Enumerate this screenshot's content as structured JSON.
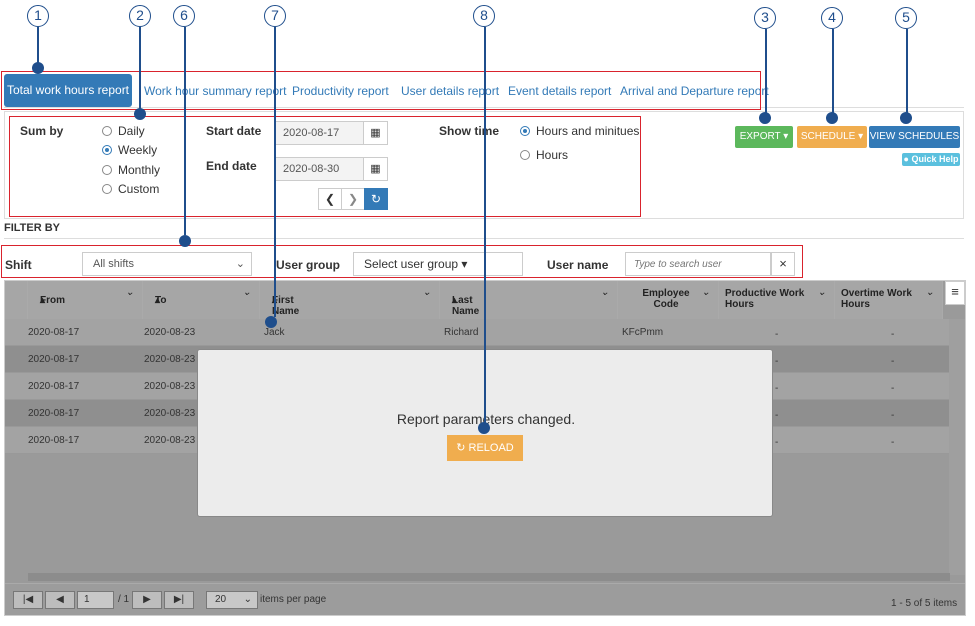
{
  "callouts": [
    "1",
    "2",
    "3",
    "4",
    "5",
    "6",
    "7",
    "8"
  ],
  "tabs": {
    "active": "Total work hours report",
    "items": [
      "Work hour summary report",
      "Productivity report",
      "User details report",
      "Event details report",
      "Arrival and Departure report"
    ]
  },
  "params": {
    "sum_by_label": "Sum by",
    "sum_by_options": [
      "Daily",
      "Weekly",
      "Monthly",
      "Custom"
    ],
    "sum_by_selected": "Weekly",
    "start_date_label": "Start date",
    "start_date": "2020-08-17",
    "end_date_label": "End date",
    "end_date": "2020-08-30",
    "show_time_label": "Show time",
    "show_time_options": [
      "Hours and minitues",
      "Hours"
    ],
    "show_time_selected": "Hours and minitues"
  },
  "actions": {
    "export": "EXPORT",
    "schedule": "SCHEDULE",
    "view_schedules": "VIEW SCHEDULES",
    "quick_help": "Quick Help",
    "colors": {
      "export": "#5cb85c",
      "schedule": "#f0ad4e",
      "view": "#337ab7",
      "help": "#5bc0de"
    }
  },
  "filter": {
    "title": "FILTER BY",
    "shift_label": "Shift",
    "shift_value": "All shifts",
    "user_group_label": "User group",
    "user_group_value": "Select user group",
    "user_name_label": "User name",
    "user_name_placeholder": "Type to search user"
  },
  "grid": {
    "columns": [
      "From",
      "To",
      "First Name",
      "Last Name",
      "Employee Code",
      "Productive Work Hours",
      "Overtime Work Hours"
    ],
    "rows": [
      [
        "2020-08-17",
        "2020-08-23",
        "Jack",
        "Richard",
        "KFcPmm",
        "-",
        "-"
      ],
      [
        "2020-08-17",
        "2020-08-23",
        "",
        "",
        "",
        "-",
        "-"
      ],
      [
        "2020-08-17",
        "2020-08-23",
        "",
        "",
        "",
        "-",
        "-"
      ],
      [
        "2020-08-17",
        "2020-08-23",
        "",
        "",
        "",
        "-",
        "-"
      ],
      [
        "2020-08-17",
        "2020-08-23",
        "",
        "",
        "",
        "-",
        "-"
      ]
    ]
  },
  "modal": {
    "message": "Report parameters changed.",
    "reload": "RELOAD"
  },
  "pager": {
    "page": "1",
    "of": "/ 1",
    "page_size": "20",
    "items_per_page": "items per page",
    "summary": "1 - 5 of 5 items"
  }
}
